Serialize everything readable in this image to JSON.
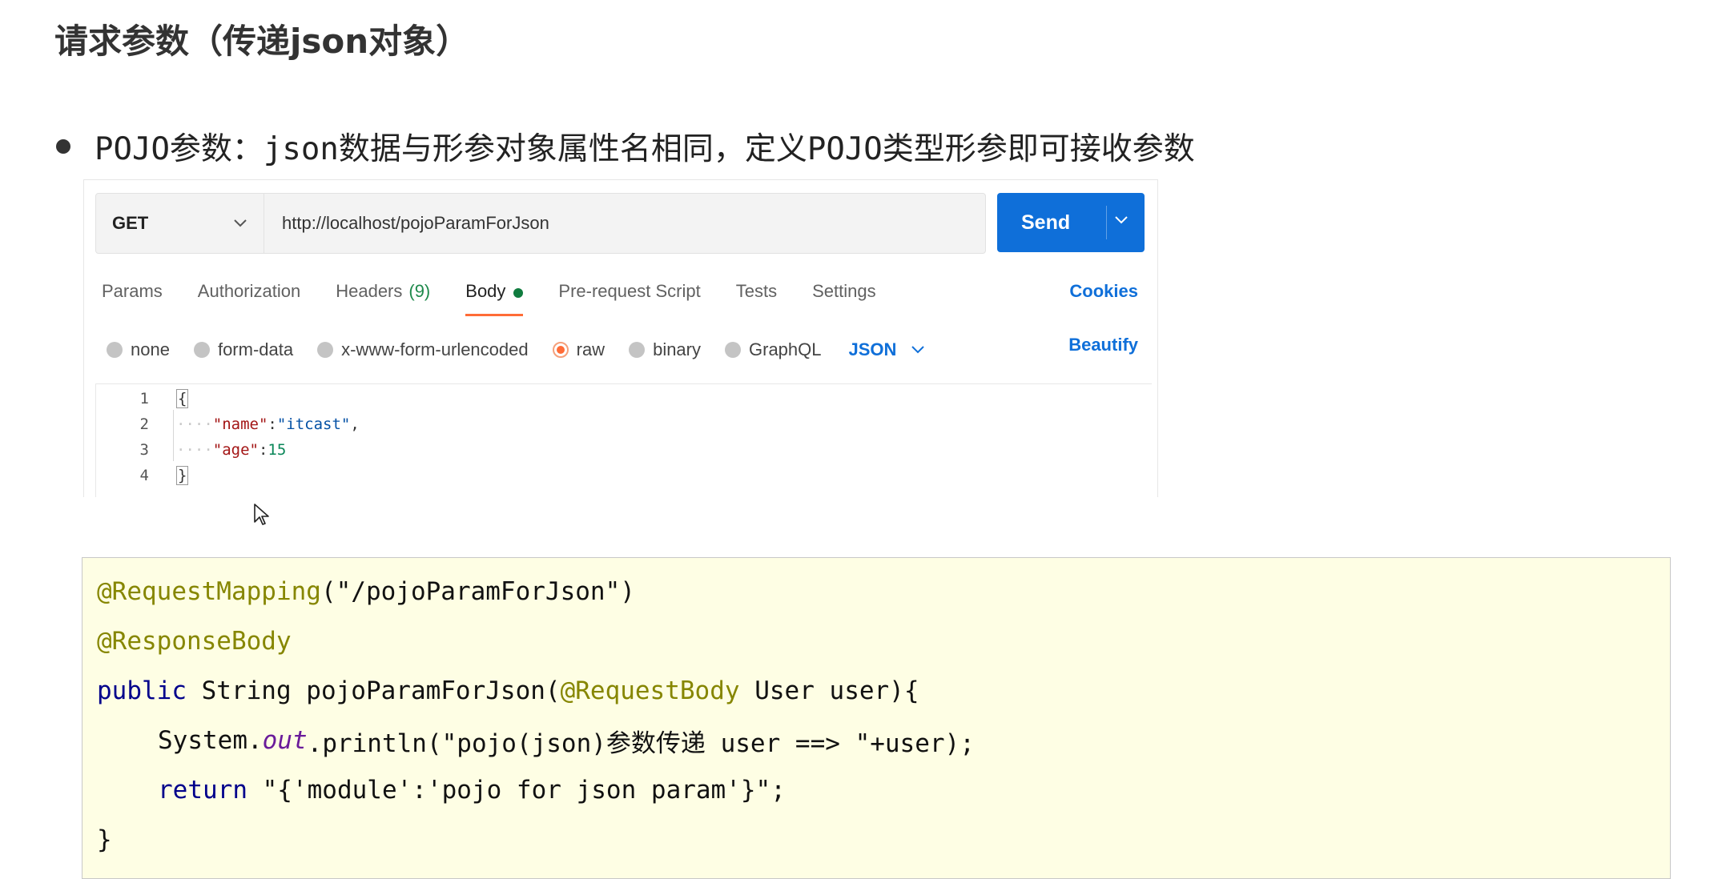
{
  "slide": {
    "title": "请求参数（传递json对象）",
    "bullet": "POJO参数：json数据与形参对象属性名相同，定义POJO类型形参即可接收参数"
  },
  "postman": {
    "method": "GET",
    "url": "http://localhost/pojoParamForJson",
    "send_label": "Send",
    "tabs": [
      {
        "label": "Params"
      },
      {
        "label": "Authorization"
      },
      {
        "label": "Headers",
        "count": "(9)"
      },
      {
        "label": "Body"
      },
      {
        "label": "Pre-request Script"
      },
      {
        "label": "Tests"
      },
      {
        "label": "Settings"
      }
    ],
    "active_tab": "Body",
    "cookies_label": "Cookies",
    "body_types": [
      {
        "label": "none"
      },
      {
        "label": "form-data"
      },
      {
        "label": "x-www-form-urlencoded"
      },
      {
        "label": "raw"
      },
      {
        "label": "binary"
      },
      {
        "label": "GraphQL"
      }
    ],
    "selected_body_type": "raw",
    "format": "JSON",
    "beautify_label": "Beautify",
    "editor": {
      "line_numbers": [
        "1",
        "2",
        "3",
        "4"
      ],
      "open_brace": "{",
      "close_brace": "}",
      "indent_dots": "····",
      "name_key": "\"name\"",
      "name_value": "\"itcast\"",
      "age_key": "\"age\"",
      "age_value": "15",
      "colon": ":",
      "comma": ","
    }
  },
  "java": {
    "line1_annotation": "@RequestMapping",
    "line1_rest": "(\"/pojoParamForJson\")",
    "line2_annotation": "@ResponseBody",
    "line3_kw": "public",
    "line3_text1": " String pojoParamForJson(",
    "line3_annotation": "@RequestBody",
    "line3_text2": " User user){",
    "line4_text1": "System.",
    "line4_field": "out",
    "line4_text2": ".println(\"pojo(json)参数传递 user ==> \"+user);",
    "line5_kw": "return",
    "line5_text": " \"{'module':'pojo for json param'}\";",
    "line6_text": "}"
  },
  "colors": {
    "send": "#0f6fd9",
    "active_tab_underline": "#ff6c37",
    "code_bg": "#fefee4",
    "annotation": "#868600",
    "keyword": "#00008b"
  }
}
